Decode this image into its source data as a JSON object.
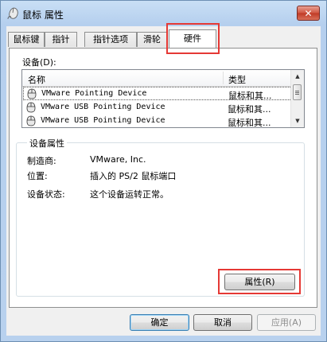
{
  "window": {
    "title": "鼠标 属性",
    "close_label": "✕"
  },
  "tabs": [
    {
      "label": "鼠标键"
    },
    {
      "label": "指针"
    },
    {
      "label": "指针选项"
    },
    {
      "label": "滑轮"
    },
    {
      "label": "硬件"
    }
  ],
  "devices": {
    "label": "设备(D):",
    "columns": {
      "name": "名称",
      "type": "类型"
    },
    "rows": [
      {
        "name": "VMware Pointing Device",
        "type": "鼠标和其..."
      },
      {
        "name": "VMware USB Pointing Device",
        "type": "鼠标和其..."
      },
      {
        "name": "VMware USB Pointing Device",
        "type": "鼠标和其..."
      }
    ]
  },
  "properties": {
    "title": "设备属性",
    "manufacturer_label": "制造商:",
    "manufacturer_value": "VMware, Inc.",
    "location_label": "位置:",
    "location_value": "插入的 PS/2 鼠标端口",
    "status_label": "设备状态:",
    "status_value": "这个设备运转正常。",
    "properties_button": "属性(R)"
  },
  "footer": {
    "ok": "确定",
    "cancel": "取消",
    "apply": "应用(A)"
  }
}
